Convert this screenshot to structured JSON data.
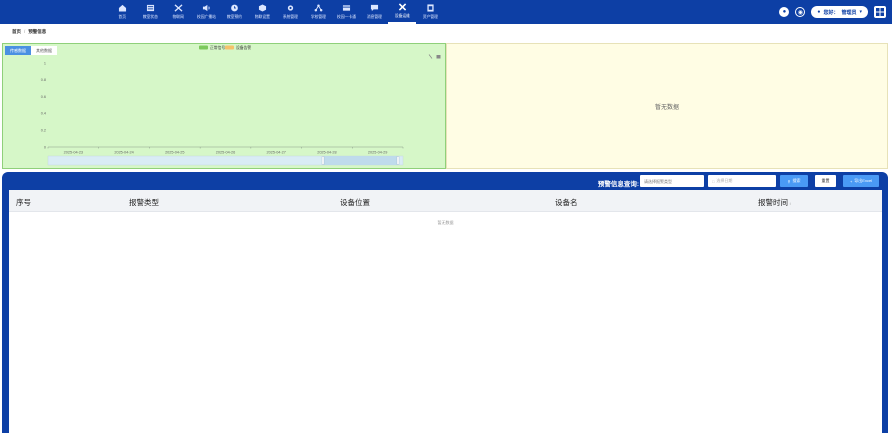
{
  "nav": {
    "items": [
      {
        "label": "首页",
        "icon": "home-icon"
      },
      {
        "label": "教室状态",
        "icon": "classroom-icon"
      },
      {
        "label": "物联网",
        "icon": "iot-icon"
      },
      {
        "label": "校园广播站",
        "icon": "broadcast-icon"
      },
      {
        "label": "教室预约",
        "icon": "clock-icon"
      },
      {
        "label": "物联设置",
        "icon": "cube-icon"
      },
      {
        "label": "系统管理",
        "icon": "gear-icon"
      },
      {
        "label": "学校管理",
        "icon": "network-icon"
      },
      {
        "label": "校园一卡通",
        "icon": "card-icon"
      },
      {
        "label": "消息管理",
        "icon": "message-icon"
      },
      {
        "label": "设备运维",
        "icon": "tools-icon",
        "active": true
      },
      {
        "label": "资产管理",
        "icon": "asset-icon"
      }
    ]
  },
  "header": {
    "greeting": "您好：",
    "username": "管理员"
  },
  "breadcrumb": {
    "home": "首页",
    "current": "预警信息"
  },
  "chart_panel": {
    "tabs": [
      "传感数据",
      "其他数据"
    ],
    "right_empty": "暂无数据"
  },
  "chart_data": {
    "type": "line",
    "legend": [
      "正常信号",
      "设备告警"
    ],
    "legend_colors": [
      "#7cc95c",
      "#f5c26b"
    ],
    "categories": [
      "2025-04-23",
      "2025-04-24",
      "2025-04-25",
      "2025-04-26",
      "2025-04-27",
      "2025-04-28",
      "2025-04-29"
    ],
    "y_ticks": [
      "1",
      "0.8",
      "0.6",
      "0.4",
      "0.2",
      "0"
    ],
    "ylim": [
      0,
      1
    ],
    "series": []
  },
  "alarm": {
    "query_label": "预警信息查询:",
    "device_placeholder": "请选择报警类型",
    "date_placeholder": "选择日期",
    "search_label": "搜索",
    "reset_label": "重置",
    "export_label": "导出Excel"
  },
  "table": {
    "headers": [
      "序号",
      "报警类型",
      "设备位置",
      "设备名",
      "报警时间"
    ],
    "empty_text": "暂无数据"
  },
  "colors": {
    "nav_bg": "#0d3fa5",
    "accent": "#4a9af5",
    "chart_left_bg": "#d6f7c8",
    "chart_right_bg": "#fffde4"
  }
}
